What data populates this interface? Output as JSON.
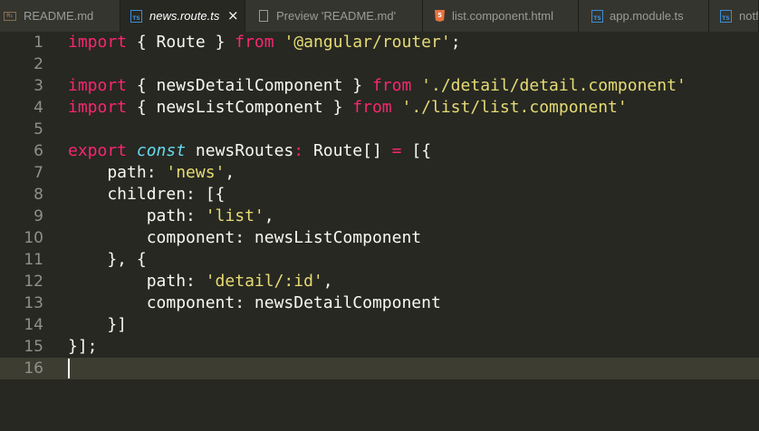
{
  "tabs": [
    {
      "label": "README.md",
      "icon": "markdown-icon",
      "icon_text": "M↓",
      "active": false
    },
    {
      "label": "news.route.ts",
      "icon": "typescript-icon",
      "icon_text": "TS",
      "active": true
    },
    {
      "label": "Preview 'README.md'",
      "icon": "file-icon",
      "icon_text": "",
      "active": false
    },
    {
      "label": "list.component.html",
      "icon": "html5-icon",
      "icon_text": "5",
      "active": false
    },
    {
      "label": "app.module.ts",
      "icon": "typescript-icon",
      "icon_text": "TS",
      "active": false
    },
    {
      "label": "notf",
      "icon": "typescript-icon",
      "icon_text": "TS",
      "active": false
    }
  ],
  "close_glyph": "×",
  "colors": {
    "background": "#272822",
    "keyword": "#f92672",
    "string": "#e6db74",
    "storage": "#66d9ef",
    "text": "#f8f8f2",
    "line_number": "#90908a",
    "current_line": "#3e3d32"
  },
  "current_line": 16,
  "code_lines": [
    [
      {
        "t": "import",
        "c": "kw"
      },
      {
        "t": " { Route } "
      },
      {
        "t": "from",
        "c": "kw"
      },
      {
        "t": " "
      },
      {
        "t": "'@angular/router'",
        "c": "str"
      },
      {
        "t": ";"
      }
    ],
    [],
    [
      {
        "t": "import",
        "c": "kw"
      },
      {
        "t": " { newsDetailComponent } "
      },
      {
        "t": "from",
        "c": "kw"
      },
      {
        "t": " "
      },
      {
        "t": "'./detail/detail.component'",
        "c": "str"
      }
    ],
    [
      {
        "t": "import",
        "c": "kw"
      },
      {
        "t": " { newsListComponent } "
      },
      {
        "t": "from",
        "c": "kw"
      },
      {
        "t": " "
      },
      {
        "t": "'./list/list.component'",
        "c": "str"
      }
    ],
    [],
    [
      {
        "t": "export",
        "c": "kw"
      },
      {
        "t": " "
      },
      {
        "t": "const",
        "c": "sto"
      },
      {
        "t": " newsRoutes"
      },
      {
        "t": ":",
        "c": "op"
      },
      {
        "t": " Route[] "
      },
      {
        "t": "=",
        "c": "op"
      },
      {
        "t": " [{"
      }
    ],
    [
      {
        "t": "    path: "
      },
      {
        "t": "'news'",
        "c": "str"
      },
      {
        "t": ","
      }
    ],
    [
      {
        "t": "    children: [{"
      }
    ],
    [
      {
        "t": "        path: "
      },
      {
        "t": "'list'",
        "c": "str"
      },
      {
        "t": ","
      }
    ],
    [
      {
        "t": "        component: newsListComponent"
      }
    ],
    [
      {
        "t": "    }, {"
      }
    ],
    [
      {
        "t": "        path: "
      },
      {
        "t": "'detail/:id'",
        "c": "str"
      },
      {
        "t": ","
      }
    ],
    [
      {
        "t": "        component: newsDetailComponent"
      }
    ],
    [
      {
        "t": "    }]"
      }
    ],
    [
      {
        "t": "}];"
      }
    ],
    []
  ]
}
